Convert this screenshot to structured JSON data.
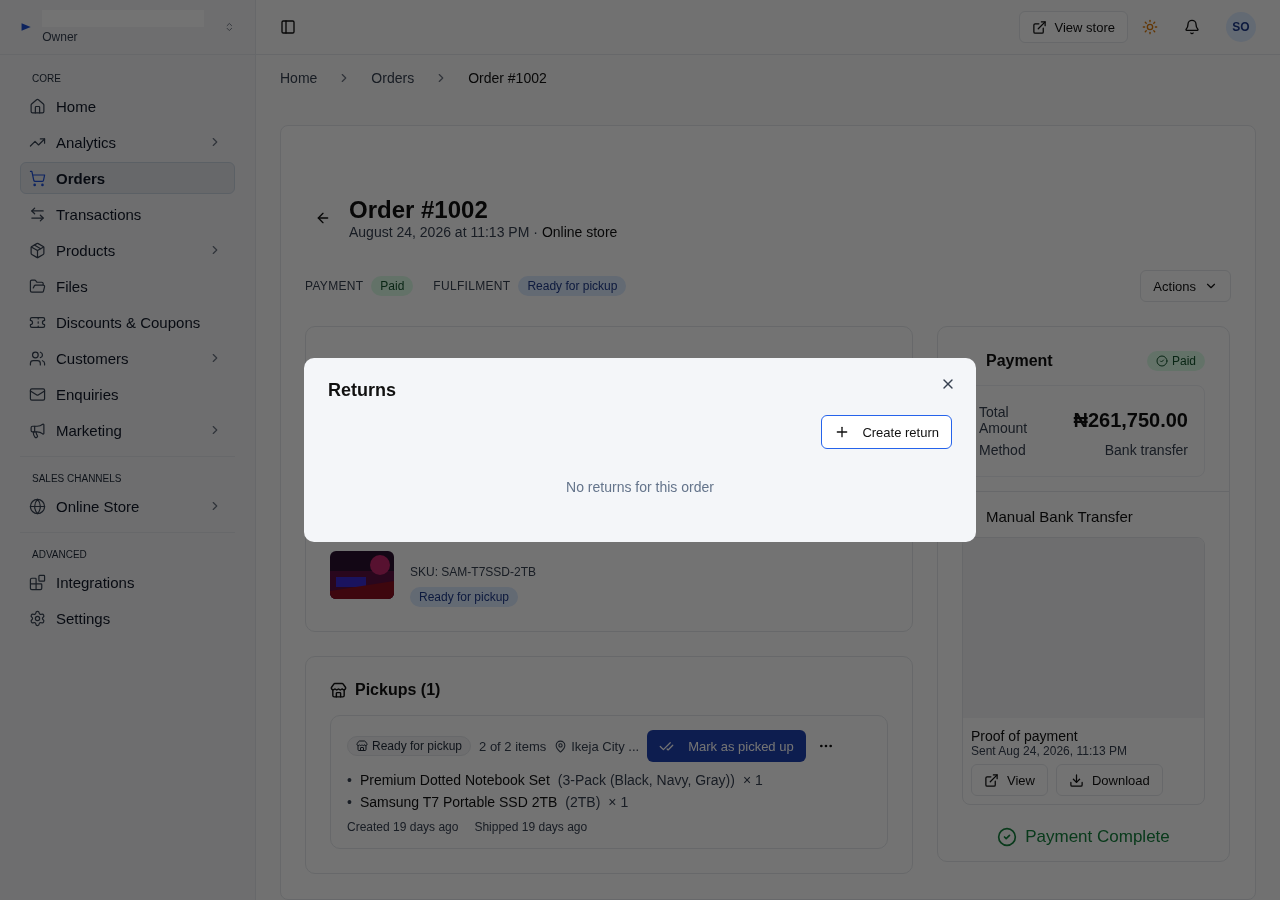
{
  "sidebar": {
    "account": {
      "role": "Owner"
    },
    "sections": [
      {
        "heading": "CORE",
        "items": [
          {
            "label": "Home",
            "selected": false,
            "submenu": false
          },
          {
            "label": "Analytics",
            "selected": false,
            "submenu": true
          },
          {
            "label": "Orders",
            "selected": true,
            "submenu": false
          },
          {
            "label": "Transactions",
            "selected": false,
            "submenu": false
          },
          {
            "label": "Products",
            "selected": false,
            "submenu": true
          },
          {
            "label": "Files",
            "selected": false,
            "submenu": false
          },
          {
            "label": "Discounts & Coupons",
            "selected": false,
            "submenu": false
          },
          {
            "label": "Customers",
            "selected": false,
            "submenu": true
          },
          {
            "label": "Enquiries",
            "selected": false,
            "submenu": false
          },
          {
            "label": "Marketing",
            "selected": false,
            "submenu": true
          }
        ]
      },
      {
        "heading": "SALES CHANNELS",
        "items": [
          {
            "label": "Online Store",
            "selected": false,
            "submenu": true
          }
        ]
      },
      {
        "heading": "ADVANCED",
        "items": [
          {
            "label": "Integrations",
            "selected": false,
            "submenu": false
          },
          {
            "label": "Settings",
            "selected": false,
            "submenu": false
          }
        ]
      }
    ]
  },
  "topbar": {
    "view_store": "View store",
    "avatar": "SO"
  },
  "breadcrumb": [
    {
      "label": "Home",
      "current": false
    },
    {
      "label": "Orders",
      "current": false
    },
    {
      "label": "Order #1002",
      "current": true
    }
  ],
  "order": {
    "title": "Order #1002",
    "date": "August 24, 2026 at 11:13 PM ·",
    "channel": "Online store",
    "payment_label": "PAYMENT",
    "payment_status": "Paid",
    "fulfilment_label": "FULFILMENT",
    "fulfilment_status": "Ready for pickup",
    "actions": "Actions"
  },
  "line_item": {
    "sku": "SKU: SAM-T7SSD-2TB",
    "status": "Ready for pickup"
  },
  "pickups": {
    "title": "Pickups (1)",
    "status": "Ready for pickup",
    "count": "2 of 2 items",
    "location": "Ikeja City ...",
    "action": "Mark as picked up",
    "items": [
      {
        "bullet": "•",
        "name": "Premium Dotted Notebook Set",
        "variant": "(3-Pack (Black, Navy, Gray))",
        "qty": "× 1"
      },
      {
        "bullet": "•",
        "name": "Samsung T7 Portable SSD 2TB",
        "variant": "(2TB)",
        "qty": "× 1"
      }
    ],
    "created": "Created 19 days ago",
    "shipped": "Shipped 19 days ago"
  },
  "payment": {
    "title": "Payment",
    "status": "Paid",
    "total_label": "Total Amount",
    "total": "₦261,750.00",
    "method_label": "Method",
    "method": "Bank transfer",
    "section": "Manual Bank Transfer",
    "proof_title": "Proof of payment",
    "proof_sent": "Sent Aug 24, 2026, 11:13 PM",
    "view": "View",
    "download": "Download",
    "complete": "Payment Complete"
  },
  "modal": {
    "title": "Returns",
    "create": "Create return",
    "empty": "No returns for this order"
  }
}
